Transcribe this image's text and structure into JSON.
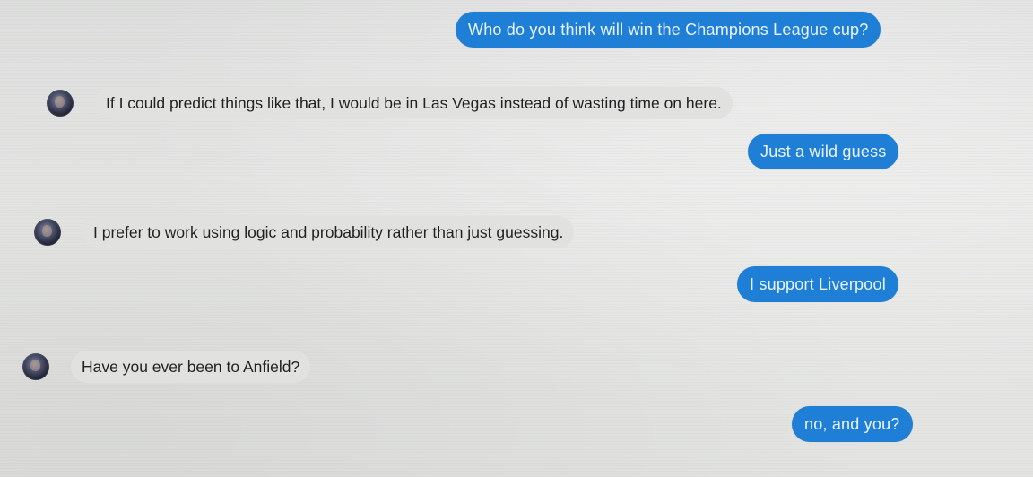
{
  "conversation": {
    "messages": [
      {
        "sender": "user",
        "text": "Who do you think will win the Champions League cup?"
      },
      {
        "sender": "bot",
        "avatar_icon": "bot-avatar-icon",
        "text": "If I could predict things like that, I would be in Las Vegas instead of wasting time on here."
      },
      {
        "sender": "user",
        "text": "Just a wild guess"
      },
      {
        "sender": "bot",
        "avatar_icon": "bot-avatar-icon",
        "text": "I prefer to work using logic and probability rather than just guessing."
      },
      {
        "sender": "user",
        "text": "I support Liverpool"
      },
      {
        "sender": "bot",
        "avatar_icon": "bot-avatar-icon",
        "text": "Have you ever been to Anfield?"
      },
      {
        "sender": "user",
        "text": "no, and you?"
      }
    ]
  },
  "colors": {
    "user_bubble": "#1f7fd6",
    "user_text": "#e9f4ff",
    "bot_bubble": "#e1e1df",
    "bot_text": "#222222",
    "background": "#e3e4e2"
  }
}
